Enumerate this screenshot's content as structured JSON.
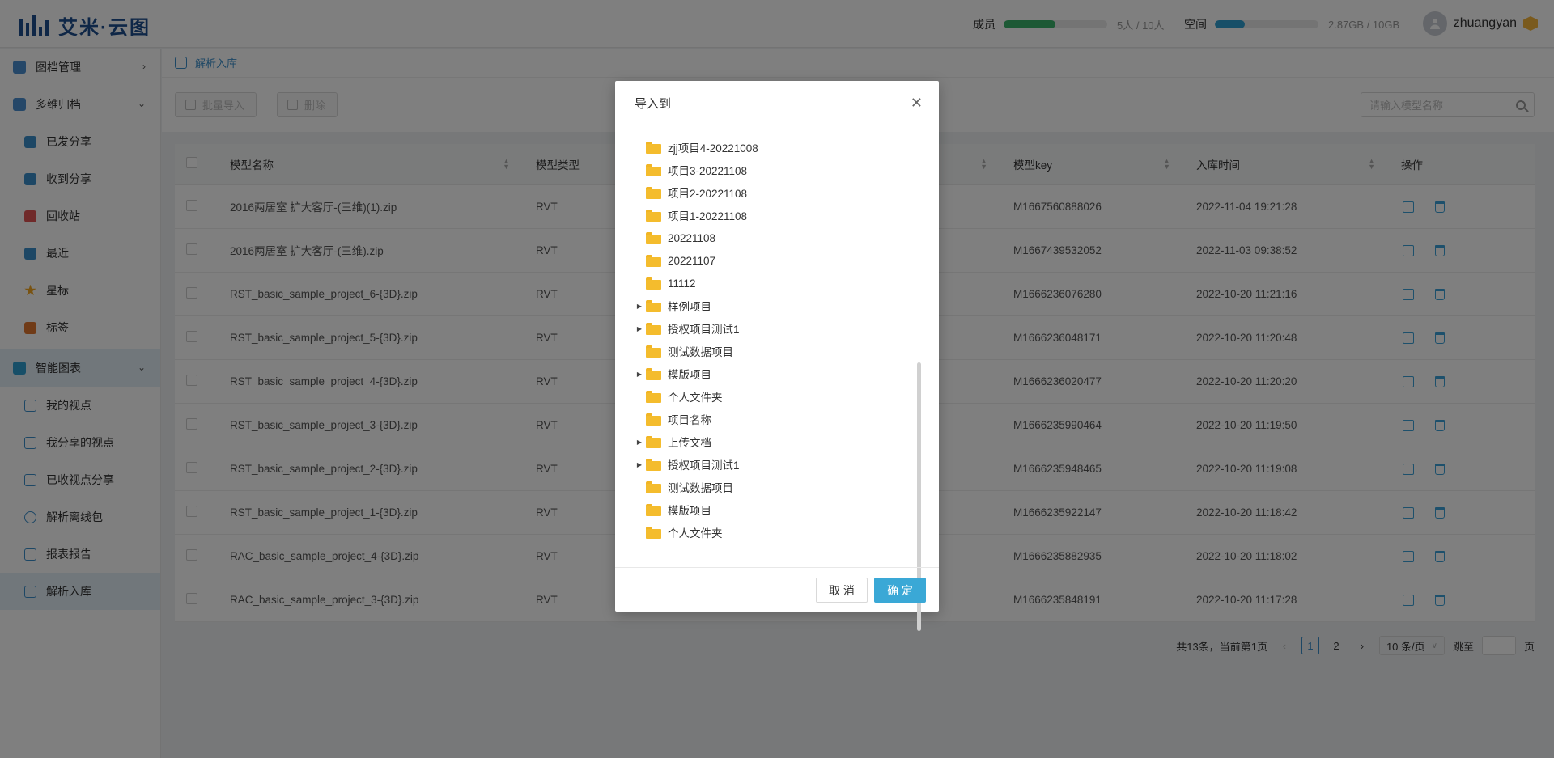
{
  "header": {
    "logo_text": "艾米·云图",
    "members_label": "成员",
    "members_value": "5人 / 10人",
    "members_fraction": 0.5,
    "space_label": "空间",
    "space_value": "2.87GB / 10GB",
    "space_fraction": 0.287,
    "username": "zhuangyan",
    "colors": {
      "members_bar": "#3ab36b",
      "space_bar": "#2f9fd0",
      "brand": "#1f4f8f"
    }
  },
  "sidebar": {
    "groups": [
      {
        "label": "图档管理",
        "icon": "folder-box-icon",
        "chevron": "›"
      },
      {
        "label": "多维归档",
        "icon": "archive-icon",
        "chevron": "⌄"
      },
      {
        "label": "智能图表",
        "icon": "smart-chart-icon",
        "chevron": "⌄"
      }
    ],
    "archive_items": [
      {
        "label": "已发分享",
        "icon": "share-sent-icon"
      },
      {
        "label": "收到分享",
        "icon": "share-received-icon"
      },
      {
        "label": "回收站",
        "icon": "trash-icon"
      },
      {
        "label": "最近",
        "icon": "recent-icon"
      },
      {
        "label": "星标",
        "icon": "star-icon"
      },
      {
        "label": "标签",
        "icon": "tag-icon"
      }
    ],
    "chart_items": [
      {
        "label": "我的视点",
        "icon": "viewpoint-icon"
      },
      {
        "label": "我分享的视点",
        "icon": "viewpoint-shared-icon"
      },
      {
        "label": "已收视点分享",
        "icon": "viewpoint-received-icon"
      },
      {
        "label": "解析离线包",
        "icon": "offline-package-icon"
      },
      {
        "label": "报表报告",
        "icon": "report-icon"
      },
      {
        "label": "解析入库",
        "icon": "import-icon"
      }
    ]
  },
  "breadcrumb": {
    "label": "解析入库"
  },
  "toolbar": {
    "batch_import": "批量导入",
    "delete": "删除",
    "search_placeholder": "请输入模型名称"
  },
  "table": {
    "columns": [
      "模型名称",
      "模型类型",
      "模型key",
      "入库时间",
      "操作"
    ],
    "rows": [
      {
        "name": "2016两居室 扩大客厅-(三维)(1).zip",
        "type": "RVT",
        "key": "M1667560888026",
        "time": "2022-11-04 19:21:28"
      },
      {
        "name": "2016两居室 扩大客厅-(三维).zip",
        "type": "RVT",
        "key": "M1667439532052",
        "time": "2022-11-03 09:38:52"
      },
      {
        "name": "RST_basic_sample_project_6-{3D}.zip",
        "type": "RVT",
        "key": "M1666236076280",
        "time": "2022-10-20 11:21:16"
      },
      {
        "name": "RST_basic_sample_project_5-{3D}.zip",
        "type": "RVT",
        "key": "M1666236048171",
        "time": "2022-10-20 11:20:48"
      },
      {
        "name": "RST_basic_sample_project_4-{3D}.zip",
        "type": "RVT",
        "key": "M1666236020477",
        "time": "2022-10-20 11:20:20"
      },
      {
        "name": "RST_basic_sample_project_3-{3D}.zip",
        "type": "RVT",
        "key": "M1666235990464",
        "time": "2022-10-20 11:19:50"
      },
      {
        "name": "RST_basic_sample_project_2-{3D}.zip",
        "type": "RVT",
        "key": "M1666235948465",
        "time": "2022-10-20 11:19:08"
      },
      {
        "name": "RST_basic_sample_project_1-{3D}.zip",
        "type": "RVT",
        "key": "M1666235922147",
        "time": "2022-10-20 11:18:42"
      },
      {
        "name": "RAC_basic_sample_project_4-{3D}.zip",
        "type": "RVT",
        "key": "M1666235882935",
        "time": "2022-10-20 11:18:02"
      },
      {
        "name": "RAC_basic_sample_project_3-{3D}.zip",
        "type": "RVT",
        "key": "M1666235848191",
        "time": "2022-10-20 11:17:28"
      }
    ]
  },
  "pager": {
    "summary": "共13条，当前第1页",
    "pages": [
      "1",
      "2"
    ],
    "current": "1",
    "page_size": "10 条/页",
    "jump_label": "跳至",
    "page_suffix": "页"
  },
  "modal": {
    "title": "导入到",
    "cancel": "取 消",
    "confirm": "确 定",
    "folders": [
      {
        "label": "zjj项目4-20221008",
        "expandable": false
      },
      {
        "label": "项目3-20221108",
        "expandable": false
      },
      {
        "label": "项目2-20221108",
        "expandable": false
      },
      {
        "label": "项目1-20221108",
        "expandable": false
      },
      {
        "label": "20221108",
        "expandable": false
      },
      {
        "label": "20221107",
        "expandable": false
      },
      {
        "label": "11112",
        "expandable": false
      },
      {
        "label": "样例项目",
        "expandable": true
      },
      {
        "label": "授权项目测试1",
        "expandable": true
      },
      {
        "label": "测试数据项目",
        "expandable": false
      },
      {
        "label": "模版项目",
        "expandable": true
      },
      {
        "label": "个人文件夹",
        "expandable": false
      },
      {
        "label": "项目名称",
        "expandable": false
      },
      {
        "label": "上传文档",
        "expandable": true
      },
      {
        "label": "授权项目测试1",
        "expandable": true
      },
      {
        "label": "测试数据项目",
        "expandable": false
      },
      {
        "label": "模版项目",
        "expandable": false
      },
      {
        "label": "个人文件夹",
        "expandable": false
      }
    ]
  }
}
